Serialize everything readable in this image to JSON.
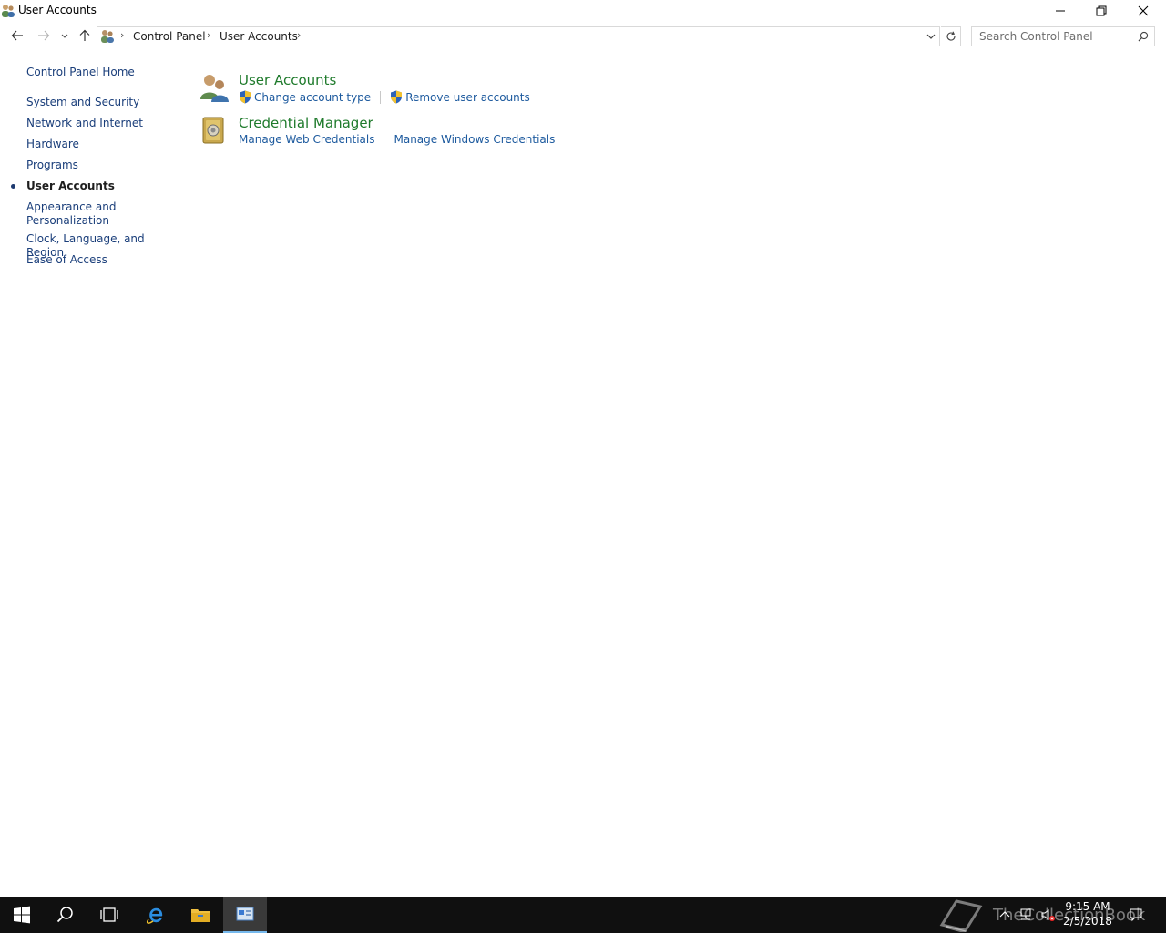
{
  "window": {
    "title": "User Accounts"
  },
  "address": {
    "crumbs": [
      "Control Panel",
      "User Accounts"
    ],
    "search_placeholder": "Search Control Panel"
  },
  "sidebar": {
    "home": "Control Panel Home",
    "items": [
      {
        "label": "System and Security",
        "active": false
      },
      {
        "label": "Network and Internet",
        "active": false
      },
      {
        "label": "Hardware",
        "active": false
      },
      {
        "label": "Programs",
        "active": false
      },
      {
        "label": "User Accounts",
        "active": true
      },
      {
        "label": "Appearance and Personalization",
        "active": false
      },
      {
        "label": "Clock, Language, and Region",
        "active": false
      },
      {
        "label": "Ease of Access",
        "active": false
      }
    ]
  },
  "main": {
    "groups": [
      {
        "title": "User Accounts",
        "links": [
          "Change account type",
          "Remove user accounts"
        ],
        "icon": "user-accounts-icon"
      },
      {
        "title": "Credential Manager",
        "links": [
          "Manage Web Credentials",
          "Manage Windows Credentials"
        ],
        "icon": "credential-manager-icon"
      }
    ]
  },
  "taskbar": {
    "time": "9:15 AM",
    "date": "2/5/2018",
    "watermark": "TheCollectionBook"
  },
  "colors": {
    "link": "#1d5a9e",
    "group_title": "#1e7a2b",
    "taskbar": "#101010"
  }
}
